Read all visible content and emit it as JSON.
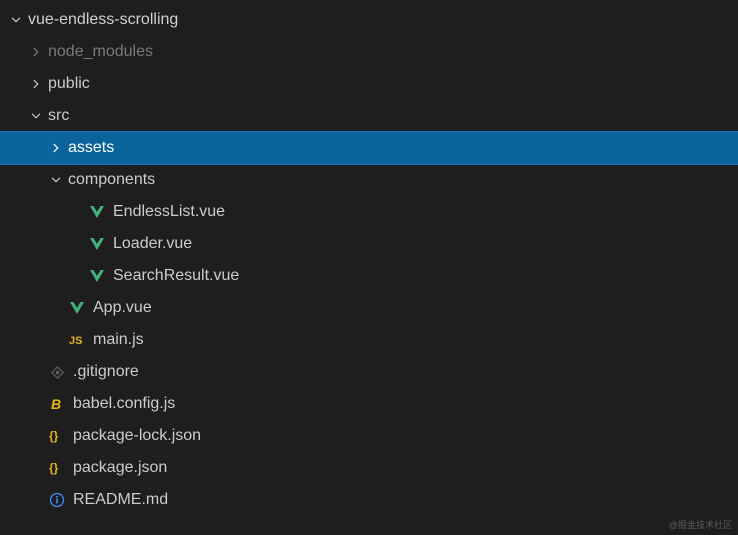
{
  "tree": {
    "root": "vue-endless-scrolling",
    "node_modules": "node_modules",
    "public": "public",
    "src": "src",
    "assets": "assets",
    "components": "components",
    "endless_list": "EndlessList.vue",
    "loader": "Loader.vue",
    "search_result": "SearchResult.vue",
    "app_vue": "App.vue",
    "main_js": "main.js",
    "gitignore": ".gitignore",
    "babel": "babel.config.js",
    "pkg_lock": "package-lock.json",
    "pkg": "package.json",
    "readme": "README.md"
  },
  "watermark": "@掘金技术社区"
}
